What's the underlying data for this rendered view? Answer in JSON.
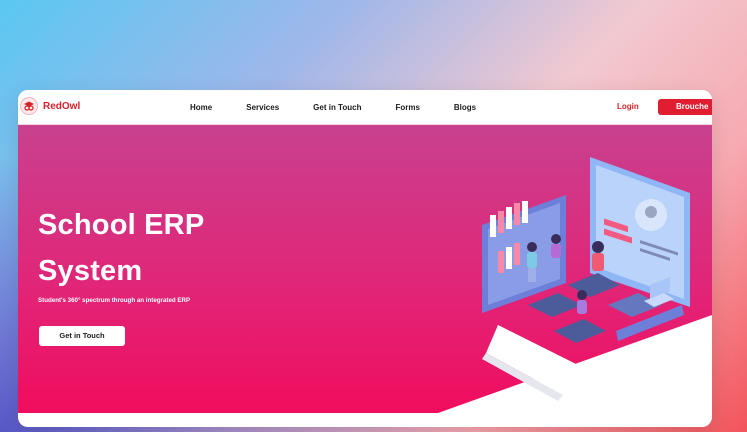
{
  "brand": {
    "name_red": "Red",
    "name_owl": "Owl"
  },
  "nav": {
    "links": [
      "Home",
      "Services",
      "Get in Touch",
      "Forms",
      "Blogs"
    ],
    "login": "Login",
    "brouche": "Brouche"
  },
  "hero": {
    "title_line1": "School ERP",
    "title_line2": "System",
    "subtitle": "Student's 360° spectrum through an integrated ERP",
    "cta": "Get in Touch"
  },
  "colors": {
    "brand_red": "#d8222b",
    "button_red": "#e01d31",
    "hero_top": "#c8418e",
    "hero_bottom": "#f20a5b"
  },
  "icons": {
    "logo": "owl-mortarboard-icon",
    "illustration": "isometric-classroom-illustration"
  }
}
